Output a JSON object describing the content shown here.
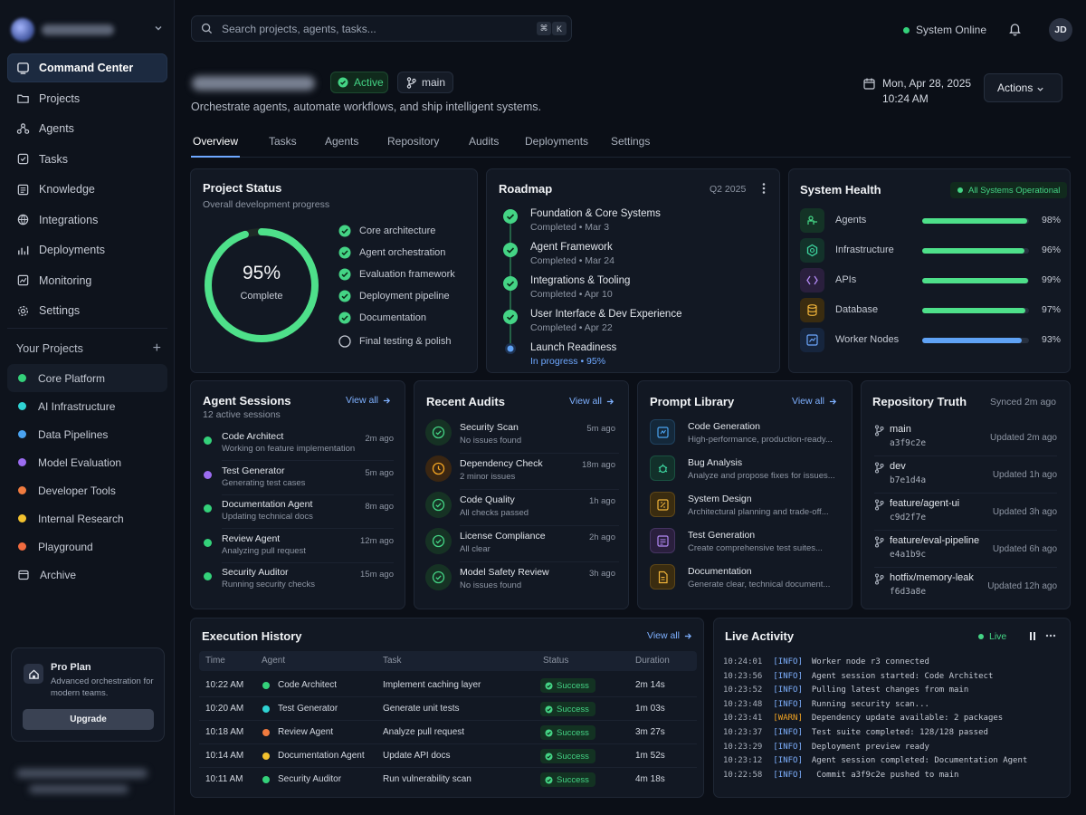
{
  "sidebar": {
    "nav": [
      {
        "label": "Command Center",
        "icon": "command-icon"
      },
      {
        "label": "Projects",
        "icon": "folder-icon"
      },
      {
        "label": "Agents",
        "icon": "agents-icon"
      },
      {
        "label": "Tasks",
        "icon": "tasks-icon"
      },
      {
        "label": "Knowledge",
        "icon": "book-icon"
      },
      {
        "label": "Integrations",
        "icon": "integrations-icon"
      },
      {
        "label": "Deployments",
        "icon": "deploy-icon"
      },
      {
        "label": "Monitoring",
        "icon": "monitor-icon"
      },
      {
        "label": "Settings",
        "icon": "gear-icon"
      }
    ],
    "your_projects_label": "Your Projects",
    "projects": [
      {
        "label": "Core Platform",
        "color": "#34d17a"
      },
      {
        "label": "AI Infrastructure",
        "color": "#2fd3d3"
      },
      {
        "label": "Data Pipelines",
        "color": "#4aa3f0"
      },
      {
        "label": "Model Evaluation",
        "color": "#9b6cf0"
      },
      {
        "label": "Developer Tools",
        "color": "#f07b3f"
      },
      {
        "label": "Internal Research",
        "color": "#f2c12e"
      },
      {
        "label": "Playground",
        "color": "#f06b3f"
      },
      {
        "label": "Archive",
        "color": ""
      }
    ],
    "plan": {
      "title": "Pro Plan",
      "description": "Advanced orchestration for modern teams.",
      "button": "Upgrade"
    }
  },
  "header": {
    "search_placeholder": "Search projects, agents, tasks...",
    "kbd": [
      "⌘",
      "K"
    ],
    "system_status": "System Online",
    "avatar_initials": "JD"
  },
  "project": {
    "status_badge": "Active",
    "branch": "main",
    "subtitle": "Orchestrate agents, automate workflows, and ship intelligent systems.",
    "date": "Mon, Apr 28, 2025",
    "time": "10:24 AM",
    "actions_label": "Actions"
  },
  "tabs": [
    "Overview",
    "Tasks",
    "Agents",
    "Repository",
    "Audits",
    "Deployments",
    "Settings"
  ],
  "status_card": {
    "title": "Project Status",
    "subtitle": "Overall development progress",
    "percent_label": "95%",
    "percent_value": 95,
    "complete_label": "Complete",
    "checklist": [
      {
        "label": "Core architecture",
        "done": true
      },
      {
        "label": "Agent orchestration",
        "done": true
      },
      {
        "label": "Evaluation framework",
        "done": true
      },
      {
        "label": "Deployment pipeline",
        "done": true
      },
      {
        "label": "Documentation",
        "done": true
      },
      {
        "label": "Final testing & polish",
        "done": false
      }
    ]
  },
  "roadmap": {
    "title": "Roadmap",
    "quarter": "Q2 2025",
    "items": [
      {
        "title": "Foundation & Core Systems",
        "status": "Completed",
        "date": "Mar 3"
      },
      {
        "title": "Agent Framework",
        "status": "Completed",
        "date": "Mar 24"
      },
      {
        "title": "Integrations & Tooling",
        "status": "Completed",
        "date": "Apr 10"
      },
      {
        "title": "User Interface & Dev Experience",
        "status": "Completed",
        "date": "Apr 22"
      },
      {
        "title": "Launch Readiness",
        "status": "In progress",
        "date": "95%"
      }
    ]
  },
  "health": {
    "title": "System Health",
    "badge": "All Systems Operational",
    "rows": [
      {
        "label": "Agents",
        "pct_label": "98%",
        "value": 0.98,
        "color": "#4ee08a",
        "icon": "agents-health-icon",
        "tint": "#143326",
        "ink": "#44d485"
      },
      {
        "label": "Infrastructure",
        "pct_label": "96%",
        "value": 0.96,
        "color": "#4ee08a",
        "icon": "hexagon-icon",
        "tint": "#13322a",
        "ink": "#3dd6a0"
      },
      {
        "label": "APIs",
        "pct_label": "99%",
        "value": 0.99,
        "color": "#4ee08a",
        "icon": "api-icon",
        "tint": "#2a1f3d",
        "ink": "#b38af5"
      },
      {
        "label": "Database",
        "pct_label": "97%",
        "value": 0.97,
        "color": "#4ee08a",
        "icon": "database-icon",
        "tint": "#3a2c10",
        "ink": "#f2b53a"
      },
      {
        "label": "Worker Nodes",
        "pct_label": "93%",
        "value": 0.93,
        "color": "#5fa2f5",
        "icon": "server-icon",
        "tint": "#16253d",
        "ink": "#6ea8ff"
      }
    ]
  },
  "sessions": {
    "title": "Agent Sessions",
    "subtitle": "12 active sessions",
    "view_all": "View all",
    "items": [
      {
        "name": "Code Architect",
        "desc": "Working on feature implementation",
        "time": "2m ago",
        "color": "#34d17a"
      },
      {
        "name": "Test Generator",
        "desc": "Generating test cases",
        "time": "5m ago",
        "color": "#9b6cf0"
      },
      {
        "name": "Documentation Agent",
        "desc": "Updating technical docs",
        "time": "8m ago",
        "color": "#34d17a"
      },
      {
        "name": "Review Agent",
        "desc": "Analyzing pull request",
        "time": "12m ago",
        "color": "#34d17a"
      },
      {
        "name": "Security Auditor",
        "desc": "Running security checks",
        "time": "15m ago",
        "color": "#34d17a"
      }
    ]
  },
  "audits": {
    "title": "Recent Audits",
    "view_all": "View all",
    "items": [
      {
        "name": "Security Scan",
        "desc": "No issues found",
        "time": "5m ago",
        "kind": "ok"
      },
      {
        "name": "Dependency Check",
        "desc": "2 minor issues",
        "time": "18m ago",
        "kind": "warn"
      },
      {
        "name": "Code Quality",
        "desc": "All checks passed",
        "time": "1h ago",
        "kind": "ok"
      },
      {
        "name": "License Compliance",
        "desc": "All clear",
        "time": "2h ago",
        "kind": "ok"
      },
      {
        "name": "Model Safety Review",
        "desc": "No issues found",
        "time": "3h ago",
        "kind": "ok"
      }
    ]
  },
  "prompts": {
    "title": "Prompt Library",
    "view_all": "View all",
    "items": [
      {
        "name": "Code Generation",
        "desc": "High-performance, production-ready...",
        "icon": "code-icon",
        "tint": "#14283a",
        "ink": "#4aa3f0"
      },
      {
        "name": "Bug Analysis",
        "desc": "Analyze and propose fixes for issues...",
        "icon": "bug-icon",
        "tint": "#12302a",
        "ink": "#3dd6a0"
      },
      {
        "name": "System Design",
        "desc": "Architectural planning and trade-off...",
        "icon": "design-icon",
        "tint": "#3a2c10",
        "ink": "#f2b53a"
      },
      {
        "name": "Test Generation",
        "desc": "Create comprehensive test suites...",
        "icon": "test-icon",
        "tint": "#2a1f3d",
        "ink": "#b38af5"
      },
      {
        "name": "Documentation",
        "desc": "Generate clear, technical document...",
        "icon": "doc-icon",
        "tint": "#3a2c10",
        "ink": "#f2b53a"
      }
    ]
  },
  "repo": {
    "title": "Repository Truth",
    "synced": "Synced 2m ago",
    "branches": [
      {
        "name": "main",
        "sha": "a3f9c2e",
        "updated": "Updated 2m ago"
      },
      {
        "name": "dev",
        "sha": "b7e1d4a",
        "updated": "Updated 1h ago"
      },
      {
        "name": "feature/agent-ui",
        "sha": "c9d2f7e",
        "updated": "Updated 3h ago"
      },
      {
        "name": "feature/eval-pipeline",
        "sha": "e4a1b9c",
        "updated": "Updated 6h ago"
      },
      {
        "name": "hotfix/memory-leak",
        "sha": "f6d3a8e",
        "updated": "Updated 12h ago"
      }
    ]
  },
  "history": {
    "title": "Execution History",
    "view_all": "View all",
    "columns": [
      "Time",
      "Agent",
      "Task",
      "Status",
      "Duration"
    ],
    "rows": [
      {
        "time": "10:22 AM",
        "agent": "Code Architect",
        "color": "#34d17a",
        "task": "Implement caching layer",
        "status": "Success",
        "duration": "2m 14s"
      },
      {
        "time": "10:20 AM",
        "agent": "Test Generator",
        "color": "#2fd3d3",
        "task": "Generate unit tests",
        "status": "Success",
        "duration": "1m 03s"
      },
      {
        "time": "10:18 AM",
        "agent": "Review Agent",
        "color": "#f07b3f",
        "task": "Analyze pull request",
        "status": "Success",
        "duration": "3m 27s"
      },
      {
        "time": "10:14 AM",
        "agent": "Documentation Agent",
        "color": "#f2c12e",
        "task": "Update API docs",
        "status": "Success",
        "duration": "1m 52s"
      },
      {
        "time": "10:11 AM",
        "agent": "Security Auditor",
        "color": "#34d17a",
        "task": "Run vulnerability scan",
        "status": "Success",
        "duration": "4m 18s"
      }
    ]
  },
  "live": {
    "title": "Live Activity",
    "live_label": "Live",
    "logs": [
      {
        "time": "10:24:01",
        "level": "[INFO]",
        "msg": "Worker node r3 connected"
      },
      {
        "time": "10:23:56",
        "level": "[INFO]",
        "msg": "Agent session started: Code Architect"
      },
      {
        "time": "10:23:52",
        "level": "[INFO]",
        "msg": "Pulling latest changes from main"
      },
      {
        "time": "10:23:48",
        "level": "[INFO]",
        "msg": "Running security scan..."
      },
      {
        "time": "10:23:41",
        "level": "[WARN]",
        "msg": "Dependency update available: 2 packages"
      },
      {
        "time": "10:23:37",
        "level": "[INFO]",
        "msg": "Test suite completed: 128/128 passed"
      },
      {
        "time": "10:23:29",
        "level": "[INFO]",
        "msg": "Deployment preview ready"
      },
      {
        "time": "10:23:12",
        "level": "[INFO]",
        "msg": "Agent session completed: Documentation Agent"
      },
      {
        "time": "10:22:58",
        "level": "[INFO]",
        "msg": " Commit a3f9c2e pushed to main"
      }
    ]
  }
}
